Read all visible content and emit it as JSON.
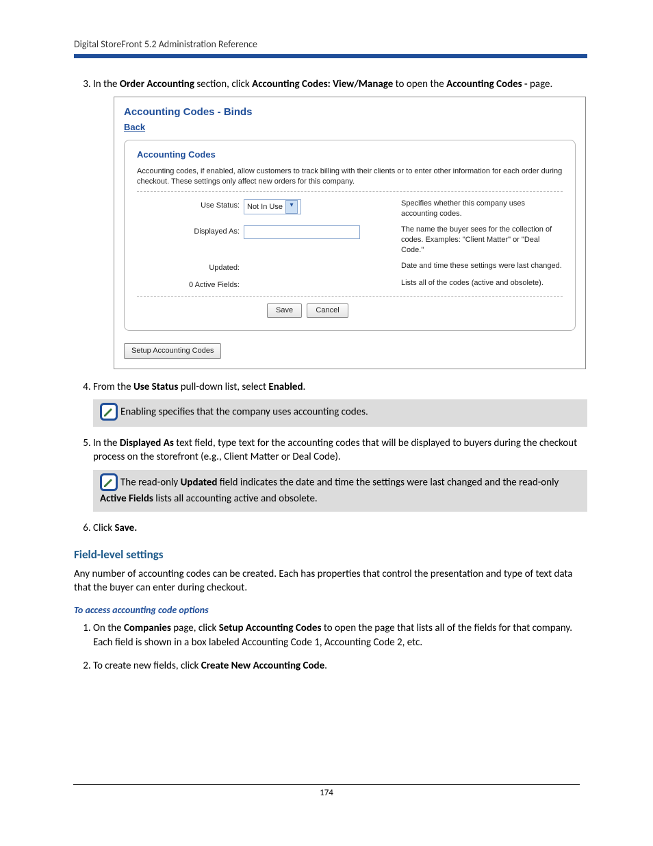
{
  "header": {
    "title": "Digital StoreFront 5.2 Administration Reference"
  },
  "step3": {
    "prefix": "In the ",
    "b1": "Order Accounting",
    "mid1": " section, click ",
    "b2": "Accounting Codes: View/Manage",
    "mid2": " to open the ",
    "b3": "Accounting Codes - ",
    "suffix": "page."
  },
  "screenshot": {
    "title": "Accounting Codes - Binds",
    "back": "Back",
    "panel_heading": "Accounting Codes",
    "intro": "Accounting codes, if enabled, allow customers to track billing with their clients or to enter other information for each order during checkout. These settings only affect new orders for this company.",
    "rows": {
      "useStatus": {
        "label": "Use Status:",
        "value": "Not In Use",
        "desc": "Specifies whether this company uses accounting codes."
      },
      "displayedAs": {
        "label": "Displayed As:",
        "desc": "The name the buyer sees for the collection of codes. Examples: \"Client Matter\" or \"Deal Code.\""
      },
      "updated": {
        "label": "Updated:",
        "desc": "Date and time these settings were last changed."
      },
      "activeFields": {
        "label": "0 Active Fields:",
        "desc": "Lists all of the codes (active and obsolete)."
      }
    },
    "buttons": {
      "save": "Save",
      "cancel": "Cancel",
      "setup": "Setup Accounting Codes"
    }
  },
  "step4": {
    "prefix": "From the ",
    "b1": "Use Status",
    "mid": " pull-down list, select ",
    "b2": "Enabled",
    "suffix": "."
  },
  "note1": "Enabling specifies that the company uses accounting codes.",
  "step5": {
    "prefix": "In the ",
    "b1": "Displayed As ",
    "rest": "text field, type text for the accounting codes that will be displayed to buyers during the checkout process on the storefront (e.g., Client Matter or Deal Code)."
  },
  "note2": {
    "t1": "The read-only ",
    "b1": "Updated",
    "t2": " field indicates the date and time the settings were last changed and the read-only ",
    "b2": "Active Fields",
    "t3": " lists all accounting active and obsolete."
  },
  "step6": {
    "prefix": "Click ",
    "b1": "Save."
  },
  "h2": "Field-level settings",
  "p_after_h2": "Any number of accounting codes can be created. Each has properties that control the presentation and type of text data that the buyer can enter during checkout.",
  "subhead": "To access accounting code options",
  "step_a1": {
    "prefix": "On the ",
    "b1": "Companies",
    "mid1": " page, click ",
    "b2": "Setup Accounting Codes ",
    "rest": "to open the page that lists all of the fields for that company. Each field is shown in a box labeled Accounting Code 1, Accounting Code 2, etc."
  },
  "step_a2": {
    "prefix": "To create new fields, click ",
    "b1": "Create New Accounting Code",
    "suffix": "."
  },
  "page_number": "174"
}
